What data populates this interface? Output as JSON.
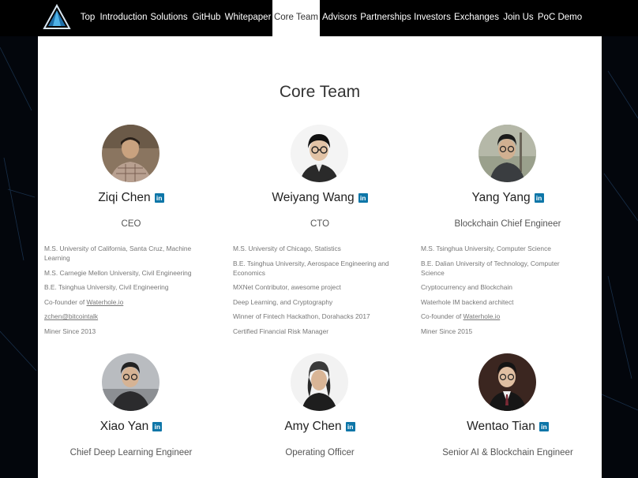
{
  "nav": {
    "items": [
      {
        "label": "Top"
      },
      {
        "label": "Introduction"
      },
      {
        "label": "Solutions"
      },
      {
        "label": "GitHub"
      },
      {
        "label": "Whitepaper"
      },
      {
        "label": "Core Team"
      },
      {
        "label": "Advisors"
      },
      {
        "label": "Partnerships"
      },
      {
        "label": "Investors"
      },
      {
        "label": "Exchanges"
      },
      {
        "label": "Join Us"
      },
      {
        "label": "PoC Demo"
      }
    ],
    "active": "Core Team"
  },
  "section": {
    "title": "Core Team"
  },
  "linkedin_glyph": "in",
  "members": [
    {
      "name": "Ziqi Chen",
      "role": "CEO",
      "details": [
        "M.S. University of California, Santa Cruz, Machine Learning",
        "M.S. Carnegie Mellon University, Civil Engineering",
        "B.E. Tsinghua University, Civil Engineering",
        "Co-founder of ",
        "zchen@bitcointalk",
        "Miner Since 2013"
      ],
      "detail_link": "Waterhole.io"
    },
    {
      "name": "Weiyang Wang",
      "role": "CTO",
      "details": [
        "M.S. University of Chicago, Statistics",
        "B.E. Tsinghua University, Aerospace Engineering and Economics",
        "MXNet Contributor, awesome project",
        "Deep Learning, and Cryptography",
        "Winner of Fintech Hackathon, Dorahacks 2017",
        "Certified Financial Risk Manager"
      ]
    },
    {
      "name": "Yang Yang",
      "role": "Blockchain Chief Engineer",
      "details": [
        "M.S. Tsinghua University, Computer Science",
        "B.E. Dalian University of Technology, Computer Science",
        "Cryptocurrency and Blockchain",
        "Waterhole IM backend architect",
        "Co-founder of ",
        "Miner Since 2015"
      ],
      "detail_link": "Waterhole.io"
    },
    {
      "name": "Xiao Yan",
      "role": "Chief Deep Learning Engineer"
    },
    {
      "name": "Amy Chen",
      "role": "Operating Officer"
    },
    {
      "name": "Wentao Tian",
      "role": "Senior AI & Blockchain Engineer"
    }
  ],
  "colors": {
    "linkedin": "#0e76a8",
    "nav_bg": "#000000",
    "accent": "#3aa0d8"
  }
}
